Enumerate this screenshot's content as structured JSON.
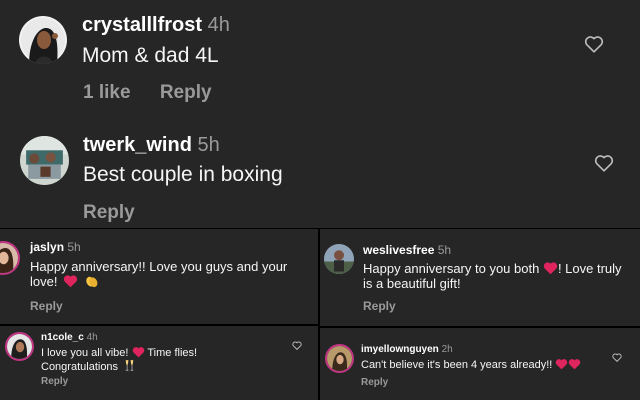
{
  "top_comments": [
    {
      "username": "crystalllfrost",
      "time": "4h",
      "text": "Mom & dad 4L",
      "likes": "1 like",
      "reply_label": "Reply",
      "avatar_icon": "profile-photo"
    },
    {
      "username": "twerk_wind",
      "time": "5h",
      "text": "Best couple in boxing",
      "reply_label": "Reply",
      "avatar_icon": "profile-photo"
    }
  ],
  "middle_left": {
    "username": "jaslyn",
    "time": "5h",
    "line1": "Happy anniversary!! Love you guys and your",
    "line2": "love!",
    "reply_label": "Reply",
    "emojis": [
      "red-heart",
      "clapping-hands"
    ]
  },
  "middle_right": {
    "username": "weslivesfree",
    "time": "5h",
    "line1_a": "Happy anniversary to you both",
    "line1_b": "! Love truly",
    "line2": "is a beautiful gift!",
    "reply_label": "Reply",
    "emojis": [
      "red-heart"
    ]
  },
  "bottom_left": {
    "username": "n1cole_c",
    "time": "4h",
    "line1_a": "I love you all vibe!",
    "line1_b": "Time flies!",
    "line2": "Congratulations",
    "reply_label": "Reply",
    "emojis": [
      "red-heart",
      "champagne-glasses"
    ]
  },
  "bottom_right": {
    "username": "imyellownguyen",
    "time": "2h",
    "text": "Can't believe it's been 4 years already!!",
    "reply_label": "Reply",
    "emojis": [
      "red-heart",
      "red-heart"
    ]
  },
  "colors": {
    "background": "#262626",
    "divider": "#000000",
    "muted_text": "#9a9a9a",
    "heart_emoji": "#e0245e"
  },
  "icons": [
    "like-heart-outline"
  ]
}
